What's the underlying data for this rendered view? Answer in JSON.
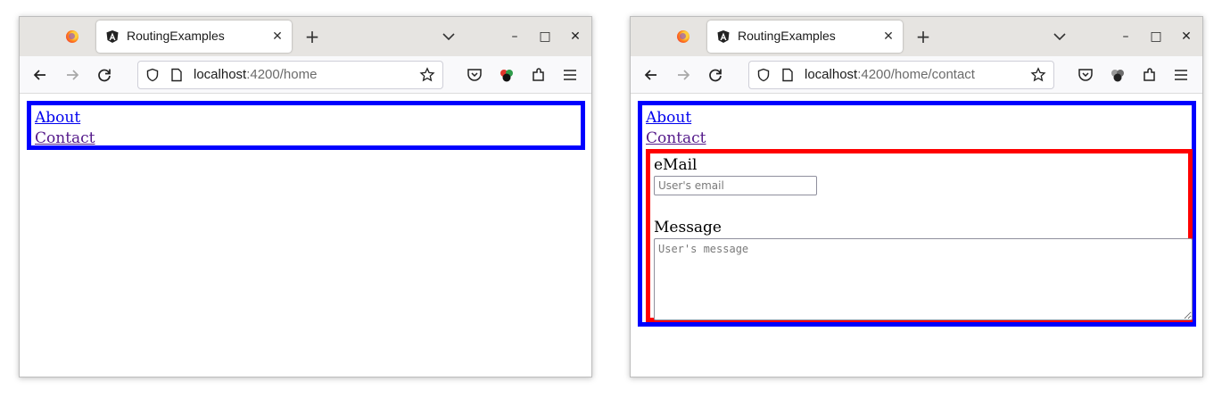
{
  "windows": [
    {
      "tab": {
        "title": "RoutingExamples",
        "close": "✕"
      },
      "new_tab": "+",
      "controls": {
        "minimize": "–",
        "maximize": "□",
        "close": "✕"
      },
      "url": {
        "host": "localhost",
        "rest": ":4200/home"
      },
      "nav_links": {
        "about": "About",
        "contact": "Contact"
      }
    },
    {
      "tab": {
        "title": "RoutingExamples",
        "close": "✕"
      },
      "new_tab": "+",
      "controls": {
        "minimize": "–",
        "maximize": "□",
        "close": "✕"
      },
      "url": {
        "host": "localhost",
        "rest": ":4200/home/contact"
      },
      "nav_links": {
        "about": "About",
        "contact": "Contact"
      },
      "contact_form": {
        "email_label": "eMail",
        "email_placeholder": "User's email",
        "email_value": "",
        "message_label": "Message",
        "message_placeholder": "User's message",
        "message_value": ""
      }
    }
  ],
  "colors": {
    "app_border": "#0000ff",
    "contact_border": "#ff0000",
    "link": "#0000ee",
    "visited_link": "#551a8b"
  }
}
